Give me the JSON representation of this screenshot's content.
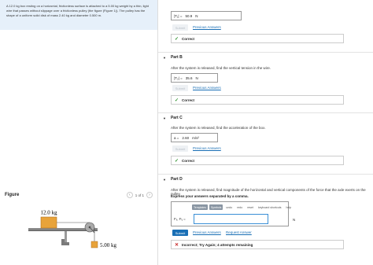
{
  "problem_text": "A 12.0 kg box resting on a horizontal, frictionless surface is attached to a 5.00 kg weight by a thin, light wire that passes without slippage over a frictionless pulley (the figure (Figure 1)). The pulley has the shape of a uniform solid disk of mass 2.40 kg and diameter 0.500 m.",
  "figure": {
    "title": "Figure",
    "pager": "1 of 1",
    "prev_icon": "chevron-left-icon",
    "next_icon": "chevron-right-icon",
    "box_label": "12.0 kg",
    "weight_label": "5.00 kg"
  },
  "part_a": {
    "answer_var": "|T₁| =",
    "answer_value": "50.9",
    "answer_unit": "N",
    "submit_label": "Submit",
    "prev_answers_label": "Previous Answers",
    "status": "Correct"
  },
  "part_b": {
    "title": "Part B",
    "question": "After the system is released, find the vertical tension in the wire.",
    "answer_var": "|T₂| =",
    "answer_value": "35.6",
    "answer_unit": "N",
    "submit_label": "Submit",
    "prev_answers_label": "Previous Answers",
    "status": "Correct"
  },
  "part_c": {
    "title": "Part C",
    "question": "After the system is released, find the acceleration of the box.",
    "answer_var": "a =",
    "answer_value": "2.60",
    "answer_unit": "m/s²",
    "submit_label": "Submit",
    "prev_answers_label": "Previous Answers",
    "status": "Correct"
  },
  "part_d": {
    "title": "Part D",
    "question": "After the system is released, find magnitude of the horizontal and vertical components of the force that the axle exerts on the pulley.",
    "instruction": "Express your answers separated by a comma.",
    "toolbar": [
      "Templates",
      "Symbols",
      "undo",
      "redo",
      "reset",
      "keyboard shortcuts",
      "help"
    ],
    "input_label": "Fₓ, Fᵧ =",
    "input_unit": "N",
    "submit_label": "Submit",
    "prev_answers_label": "Previous Answers",
    "request_answer_label": "Request Answer",
    "status": "Incorrect; Try Again; 4 attempts remaining"
  },
  "colors": {
    "link": "#1a6fb5",
    "correct": "#2a8f2a",
    "incorrect": "#c62828",
    "problem_bg": "#e6f0fa"
  }
}
